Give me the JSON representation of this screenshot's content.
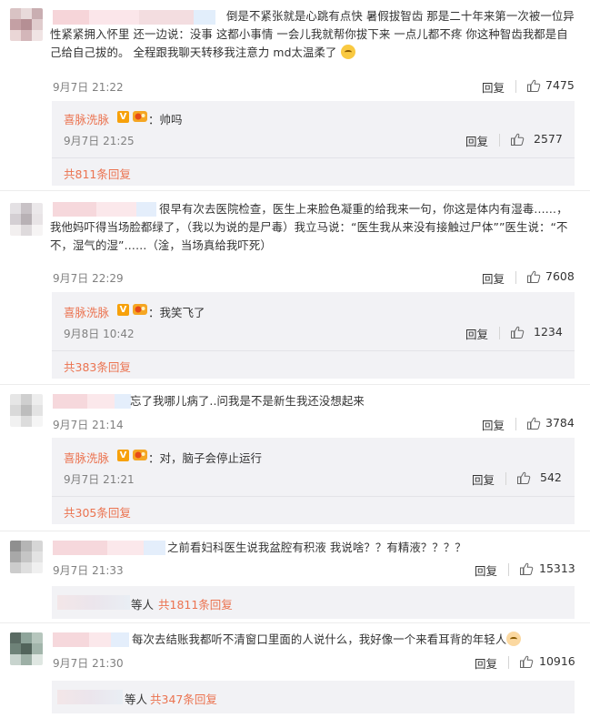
{
  "comments": [
    {
      "text": "倒是不紧张就是心跳有点快 暑假拔智齿 那是二十年来第一次被一位异性紧紧拥入怀里 还一边说：没事 这都小事情 一会儿我就帮你拔下来 一点儿都不疼 你这种智齿我都是自己给自己拔的。 全程跟我聊天转移我注意力 md太温柔了",
      "time": "9月7日 21:22",
      "reply_label": "回复",
      "likes": "7475",
      "sub": {
        "name": "喜脉洗脉",
        "text": "：帅吗",
        "time": "9月7日 21:25",
        "reply_label": "回复",
        "likes": "2577"
      },
      "more": "共811条回复"
    },
    {
      "text": "很早有次去医院检查，医生上来脸色凝重的给我来一句，你这是体内有湿毒……，我他妈吓得当场脸都绿了，（我以为说的是尸毒）我立马说：“医生我从来没有接触过尸体””医生说：“不不，湿气的湿”……（淦，当场真给我吓死）",
      "time": "9月7日 22:29",
      "reply_label": "回复",
      "likes": "7608",
      "sub": {
        "name": "喜脉洗脉",
        "text": "：我笑飞了",
        "time": "9月8日 10:42",
        "reply_label": "回复",
        "likes": "1234"
      },
      "more": "共383条回复"
    },
    {
      "text": "忘了我哪儿病了..问我是不是新生我还没想起来",
      "time": "9月7日 21:14",
      "reply_label": "回复",
      "likes": "3784",
      "sub": {
        "name": "喜脉洗脉",
        "text": "：对，脑子会停止运行",
        "time": "9月7日 21:21",
        "reply_label": "回复",
        "likes": "542"
      },
      "more": "共305条回复"
    },
    {
      "text": "之前看妇科医生说我盆腔有积液 我说啥？？有精液？？？？",
      "time": "9月7日 21:33",
      "reply_label": "回复",
      "likes": "15313",
      "mini": {
        "who": "等人",
        "count": "共1811条回复"
      }
    },
    {
      "text": "每次去结账我都听不清窗口里面的人说什么，我好像一个来看耳背的年轻人",
      "time": "9月7日 21:30",
      "reply_label": "回复",
      "likes": "10916",
      "mini": {
        "who": "等人",
        "count": "共347条回复"
      }
    }
  ],
  "colors": {
    "link": "#eb7350",
    "time": "#808080",
    "sub_bg": "#f2f2f5",
    "vip_badge": "#f7a10b"
  },
  "icons": {
    "like": "thumb-up-icon",
    "verified": "verified-v-icon",
    "level": "level-badge-icon",
    "emoji_cry": "crying-face-emoji",
    "emoji_sweat": "awkward-face-emoji"
  }
}
